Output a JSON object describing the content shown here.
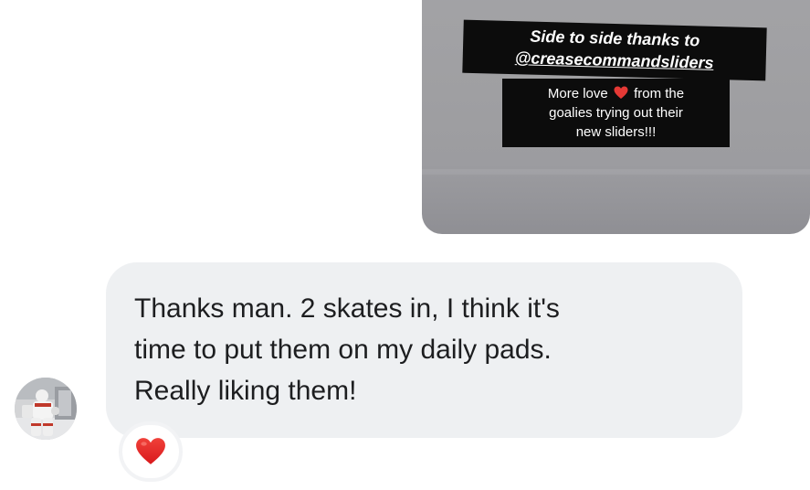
{
  "story": {
    "headline_line1": "Side to side thanks to",
    "headline_line2": "@creasecommandsliders",
    "caption_line1_before": "More love",
    "caption_line1_after": "from the",
    "caption_line2": "goalies trying out their",
    "caption_line3": "new sliders!!!",
    "inline_icon": "heart-icon"
  },
  "message": {
    "line1": "Thanks man. 2 skates in, I think it's",
    "line2": "time to put them on my daily pads.",
    "line3": "Really liking them!"
  },
  "reaction": {
    "icon": "heart-icon",
    "color": "#e0201f"
  },
  "sender": {
    "avatar": "hockey-goalie-avatar"
  },
  "colors": {
    "bubble": "#eef0f2",
    "story_background": "#a0a0a3",
    "heart": "#e0201f"
  }
}
